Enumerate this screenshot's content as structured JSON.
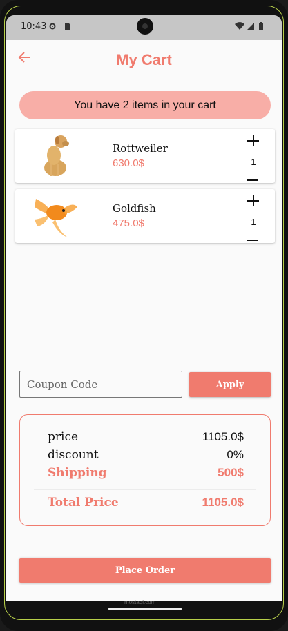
{
  "status": {
    "time": "10:43"
  },
  "header": {
    "title": "My Cart"
  },
  "banner": {
    "text": "You have 2 items in your cart"
  },
  "items": [
    {
      "name": "Rottweiler",
      "price": "630.0$",
      "qty": "1",
      "image_icon": "dog-photo-icon"
    },
    {
      "name": "Goldfish",
      "price": "475.0$",
      "qty": "1",
      "image_icon": "goldfish-photo-icon"
    }
  ],
  "coupon": {
    "placeholder": "Coupon Code",
    "value": "",
    "apply_label": "Apply"
  },
  "summary": {
    "price_label": "price",
    "price_value": "1105.0$",
    "discount_label": "discount",
    "discount_value": "0%",
    "shipping_label": "Shipping",
    "shipping_value": "500$",
    "total_label": "Total Price",
    "total_value": "1105.0$"
  },
  "footer": {
    "place_order_label": "Place Order",
    "watermark": "mostaql.com"
  },
  "colors": {
    "accent": "#f07b6e",
    "banner": "#f8aea7"
  }
}
